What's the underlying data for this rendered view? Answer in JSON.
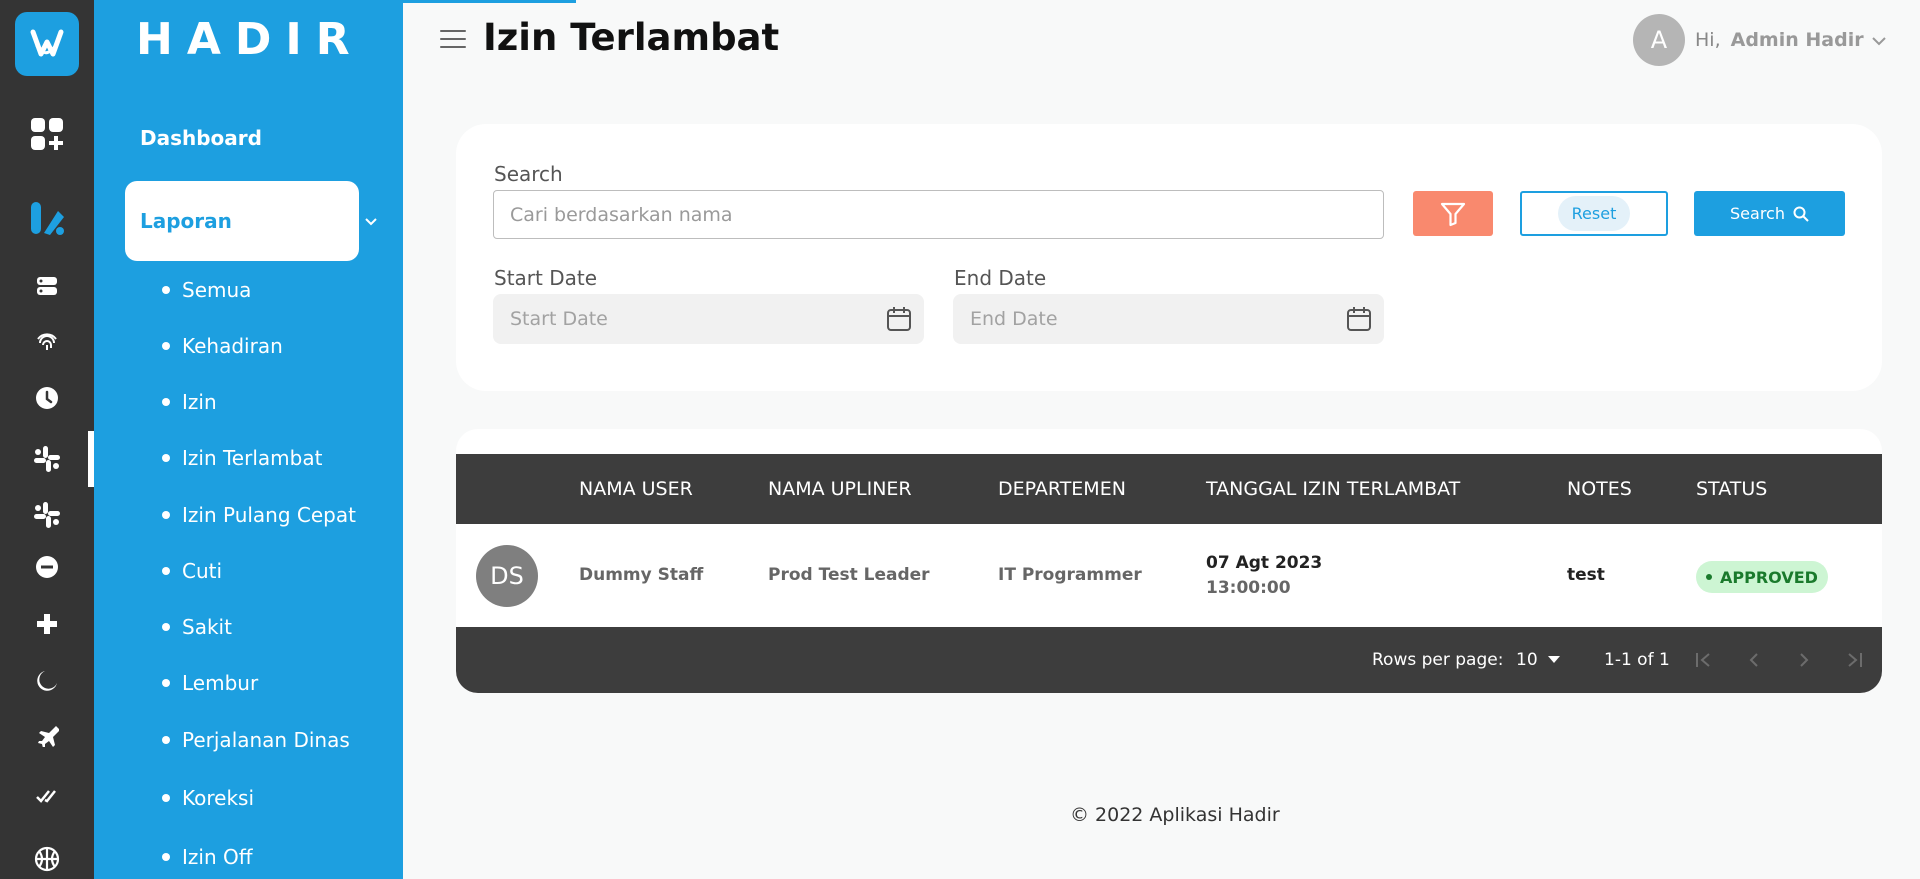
{
  "brand": "HADIR",
  "page_title": "Izin Terlambat",
  "user": {
    "avatar_initial": "A",
    "greeting": "Hi,",
    "name": "Admin Hadir"
  },
  "sidebar": {
    "dashboard": "Dashboard",
    "group_label": "Laporan",
    "items": [
      {
        "label": "Semua"
      },
      {
        "label": "Kehadiran"
      },
      {
        "label": "Izin"
      },
      {
        "label": "Izin Terlambat"
      },
      {
        "label": "Izin Pulang Cepat"
      },
      {
        "label": "Cuti"
      },
      {
        "label": "Sakit"
      },
      {
        "label": "Lembur"
      },
      {
        "label": "Perjalanan Dinas"
      },
      {
        "label": "Koreksi"
      },
      {
        "label": "Izin Off"
      }
    ]
  },
  "filters": {
    "search_label": "Search",
    "search_placeholder": "Cari berdasarkan nama",
    "search_value": "",
    "reset_label": "Reset",
    "search_button_label": "Search",
    "start_date_label": "Start Date",
    "start_date_placeholder": "Start Date",
    "end_date_label": "End Date",
    "end_date_placeholder": "End Date",
    "filter_color": "#f9896e",
    "accent_color": "#1d9fe0"
  },
  "table": {
    "columns": [
      "NAMA USER",
      "NAMA UPLINER",
      "DEPARTEMEN",
      "TANGGAL IZIN TERLAMBAT",
      "NOTES",
      "STATUS"
    ],
    "rows": [
      {
        "avatar_initials": "DS",
        "nama_user": "Dummy Staff",
        "nama_upliner": "Prod Test Leader",
        "departemen": "IT Programmer",
        "tanggal": "07 Agt 2023",
        "jam": "13:00:00",
        "notes": "test",
        "status": "APPROVED"
      }
    ],
    "pagination": {
      "rows_per_page_label": "Rows per page:",
      "rows_per_page": "10",
      "range": "1-1 of 1"
    }
  },
  "footer": "© 2022 Aplikasi Hadir"
}
